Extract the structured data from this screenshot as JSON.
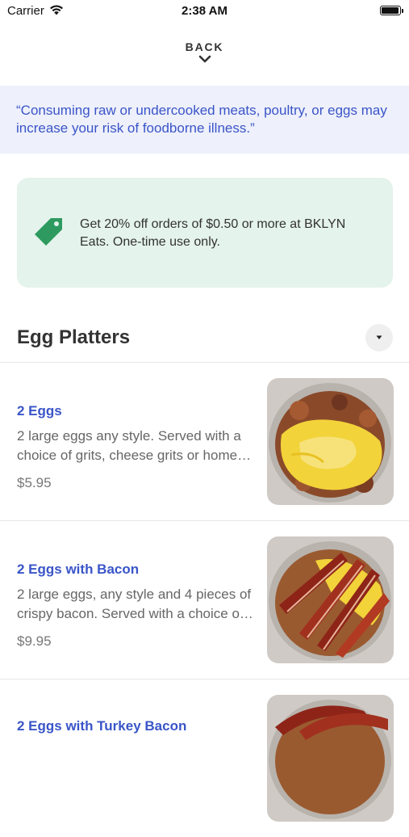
{
  "status_bar": {
    "carrier": "Carrier",
    "time": "2:38 AM"
  },
  "nav": {
    "back_label": "BACK"
  },
  "warning": {
    "text": "“Consuming raw or undercooked meats, poultry, or eggs may increase your risk of foodborne illness.”"
  },
  "promo": {
    "text": "Get 20% off orders of $0.50 or more at BKLYN Eats. One-time use only."
  },
  "section": {
    "title": "Egg Platters"
  },
  "items": [
    {
      "name": "2 Eggs",
      "description": "2 large eggs any style. Served with a choice of grits, cheese grits or home fries",
      "price": "$5.95"
    },
    {
      "name": "2 Eggs with Bacon",
      "description": "2 large eggs, any style and 4 pieces of crispy bacon. Served with a choice of grits",
      "price": "$9.95"
    },
    {
      "name": "2 Eggs with Turkey Bacon"
    }
  ],
  "colors": {
    "accent": "#3a55c8",
    "promo_bg": "#e4f3ec",
    "tag": "#2e9a5f",
    "warning_bg": "#eef0fb"
  },
  "icons": {
    "wifi": "wifi-icon",
    "battery": "battery-icon",
    "back": "chevron-down-icon",
    "promo": "price-tag-icon",
    "dropdown": "caret-down-icon"
  }
}
